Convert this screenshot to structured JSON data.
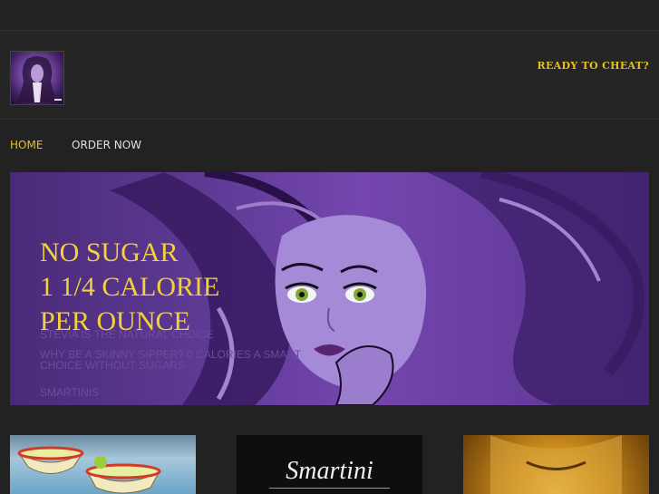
{
  "header": {
    "tagline": "READY TO CHEAT?",
    "logo_icon": "woman-portrait-logo-icon"
  },
  "nav": {
    "items": [
      {
        "label": "HOME",
        "active": true
      },
      {
        "label": "ORDER NOW",
        "active": false
      }
    ]
  },
  "hero": {
    "headline": [
      "NO SUGAR",
      "1 1/4 CALORIE",
      "PER OUNCE"
    ],
    "body": [
      "STEVIA IS THE NATURAL CHOICE",
      "WHY BE A SKINNY SIPPER? 0 CALORIES A SMART CHOICE WITHOUT SUGARS",
      "SMARTINIS"
    ]
  },
  "thumbnails": {
    "smartini_label": "Smartini"
  },
  "colors": {
    "background": "#222222",
    "accent_gold": "#e8c01c",
    "hero_purple": "#5e3a94"
  }
}
